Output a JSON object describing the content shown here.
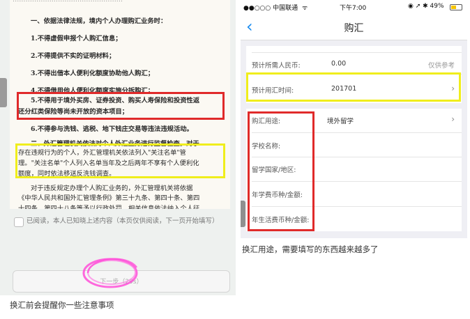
{
  "left_screen": {
    "doc_lines": [
      "一、依据法律法规，境内个人办理购汇业务时：",
      "1.不得虚假申报个人购汇信息；",
      "2.不得提供不实的证明材料；",
      "3.不得出借本人便利化额度协助他人购汇；",
      "4.不得借用他人便利化额度实施分拆购汇；",
      "5.不得用于境外买房、证券投资、购买人寿保险和投资性返",
      "还分红类保险等尚未开放的资本项目；",
      "6.不得参与洗钱、逃税、地下钱庄交易等违法违规活动。",
      "二、外汇管理机关依法对个人外汇业务进行监督检查。对于",
      "存在违规行为的个人，外汇管理机关依法列入\"关注名单\"管",
      "理。\"关注名单\"个人列入名单当年及之后两年不享有个人便利化",
      "额度，同时依法移送反洗钱调查。",
      "对于违反规定办理个人购汇业务的，外汇管理机关将依据",
      "《中华人民共和国外汇管理条例》第三十九条、第四十条、第四",
      "十四条、第四十八条等予以行政处罚，相关信息依法纳入个人征"
    ],
    "agree_text": "已阅读，本人已知晓上述内容（本页仅供阅读，下一页开始填写）",
    "next_button": "下一步（29s）",
    "caption": "换汇前会提醒你一些注意事项"
  },
  "right_screen": {
    "status": {
      "carrier": "●●○○○ 中国联通",
      "wifi": "ᯤ",
      "time": "下午7:00",
      "indicators": "◉ ➚ ✱ 49%",
      "battery_level": 0.49
    },
    "nav": {
      "back": "‹",
      "title": "购汇"
    },
    "rows": {
      "estimate_label": "预计所需人民币:",
      "estimate_value": "0.00",
      "estimate_note": "仅供参考",
      "time_label": "预计用汇时间:",
      "time_value": "201701",
      "purpose_label": "购汇用途:",
      "purpose_value": "境外留学",
      "school_label": "学校名称:",
      "country_label": "留学国家/地区:",
      "tuition_label": "年学费币种/金额:",
      "living_label": "年生活费币种/金额:"
    },
    "chevron": "›",
    "caption": "换汇用途，需要填写的东西越来越多了"
  },
  "colors": {
    "highlight_red": "#e02a2a",
    "highlight_yellow": "#f0ee1c",
    "ios_blue": "#1a8cf0",
    "pink_scribble": "#ff4fd8"
  }
}
